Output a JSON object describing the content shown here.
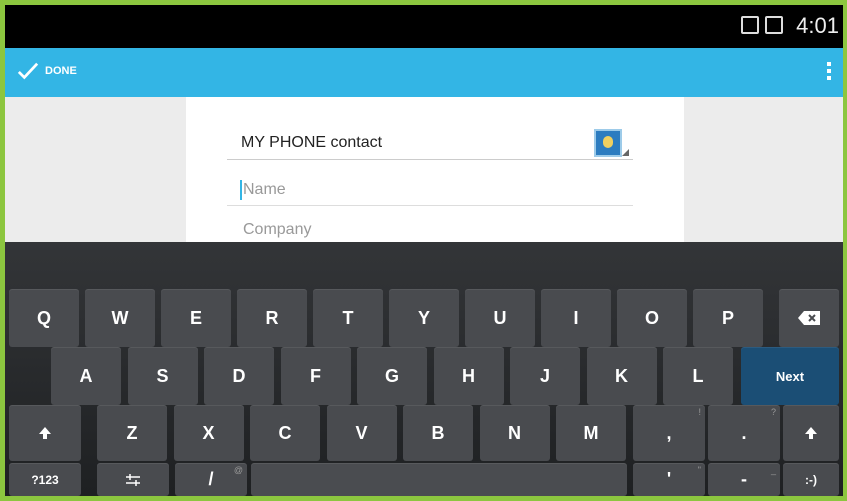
{
  "status_bar": {
    "time": "4:01"
  },
  "action_bar": {
    "done_label": "DONE"
  },
  "form": {
    "account": "MY PHONE contact",
    "name_placeholder": "Name",
    "company_placeholder": "Company"
  },
  "keyboard": {
    "row1": [
      "Q",
      "W",
      "E",
      "R",
      "T",
      "Y",
      "U",
      "I",
      "O",
      "P"
    ],
    "row2": [
      "A",
      "S",
      "D",
      "F",
      "G",
      "H",
      "J",
      "K",
      "L"
    ],
    "row3": [
      "Z",
      "X",
      "C",
      "V",
      "B",
      "N",
      "M"
    ],
    "next_label": "Next",
    "symbols_label": "?123",
    "comma": ",",
    "period": ".",
    "hint_comma": "!",
    "hint_period": "?",
    "slash": "/",
    "hint_slash": "@",
    "apostrophe": "'",
    "hint_apostrophe": "\"",
    "dash": "-",
    "hint_dash": "_",
    "smiley": ":-)"
  },
  "colors": {
    "accent": "#33b5e5",
    "next_key": "#1b4e75",
    "frame": "#8cc63f"
  }
}
